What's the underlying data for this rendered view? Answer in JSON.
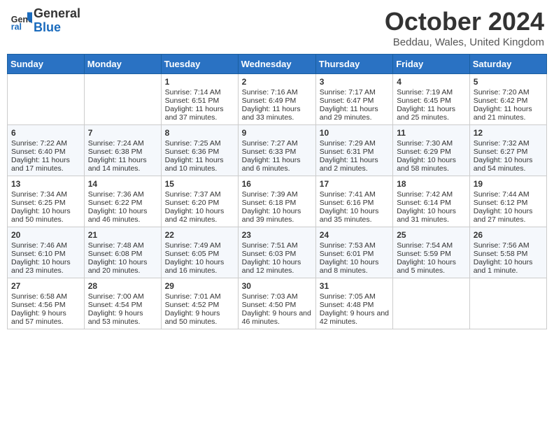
{
  "header": {
    "logo_line1": "General",
    "logo_line2": "Blue",
    "month": "October 2024",
    "location": "Beddau, Wales, United Kingdom"
  },
  "days_of_week": [
    "Sunday",
    "Monday",
    "Tuesday",
    "Wednesday",
    "Thursday",
    "Friday",
    "Saturday"
  ],
  "weeks": [
    [
      {
        "day": "",
        "content": ""
      },
      {
        "day": "",
        "content": ""
      },
      {
        "day": "1",
        "content": "Sunrise: 7:14 AM\nSunset: 6:51 PM\nDaylight: 11 hours and 37 minutes."
      },
      {
        "day": "2",
        "content": "Sunrise: 7:16 AM\nSunset: 6:49 PM\nDaylight: 11 hours and 33 minutes."
      },
      {
        "day": "3",
        "content": "Sunrise: 7:17 AM\nSunset: 6:47 PM\nDaylight: 11 hours and 29 minutes."
      },
      {
        "day": "4",
        "content": "Sunrise: 7:19 AM\nSunset: 6:45 PM\nDaylight: 11 hours and 25 minutes."
      },
      {
        "day": "5",
        "content": "Sunrise: 7:20 AM\nSunset: 6:42 PM\nDaylight: 11 hours and 21 minutes."
      }
    ],
    [
      {
        "day": "6",
        "content": "Sunrise: 7:22 AM\nSunset: 6:40 PM\nDaylight: 11 hours and 17 minutes."
      },
      {
        "day": "7",
        "content": "Sunrise: 7:24 AM\nSunset: 6:38 PM\nDaylight: 11 hours and 14 minutes."
      },
      {
        "day": "8",
        "content": "Sunrise: 7:25 AM\nSunset: 6:36 PM\nDaylight: 11 hours and 10 minutes."
      },
      {
        "day": "9",
        "content": "Sunrise: 7:27 AM\nSunset: 6:33 PM\nDaylight: 11 hours and 6 minutes."
      },
      {
        "day": "10",
        "content": "Sunrise: 7:29 AM\nSunset: 6:31 PM\nDaylight: 11 hours and 2 minutes."
      },
      {
        "day": "11",
        "content": "Sunrise: 7:30 AM\nSunset: 6:29 PM\nDaylight: 10 hours and 58 minutes."
      },
      {
        "day": "12",
        "content": "Sunrise: 7:32 AM\nSunset: 6:27 PM\nDaylight: 10 hours and 54 minutes."
      }
    ],
    [
      {
        "day": "13",
        "content": "Sunrise: 7:34 AM\nSunset: 6:25 PM\nDaylight: 10 hours and 50 minutes."
      },
      {
        "day": "14",
        "content": "Sunrise: 7:36 AM\nSunset: 6:22 PM\nDaylight: 10 hours and 46 minutes."
      },
      {
        "day": "15",
        "content": "Sunrise: 7:37 AM\nSunset: 6:20 PM\nDaylight: 10 hours and 42 minutes."
      },
      {
        "day": "16",
        "content": "Sunrise: 7:39 AM\nSunset: 6:18 PM\nDaylight: 10 hours and 39 minutes."
      },
      {
        "day": "17",
        "content": "Sunrise: 7:41 AM\nSunset: 6:16 PM\nDaylight: 10 hours and 35 minutes."
      },
      {
        "day": "18",
        "content": "Sunrise: 7:42 AM\nSunset: 6:14 PM\nDaylight: 10 hours and 31 minutes."
      },
      {
        "day": "19",
        "content": "Sunrise: 7:44 AM\nSunset: 6:12 PM\nDaylight: 10 hours and 27 minutes."
      }
    ],
    [
      {
        "day": "20",
        "content": "Sunrise: 7:46 AM\nSunset: 6:10 PM\nDaylight: 10 hours and 23 minutes."
      },
      {
        "day": "21",
        "content": "Sunrise: 7:48 AM\nSunset: 6:08 PM\nDaylight: 10 hours and 20 minutes."
      },
      {
        "day": "22",
        "content": "Sunrise: 7:49 AM\nSunset: 6:05 PM\nDaylight: 10 hours and 16 minutes."
      },
      {
        "day": "23",
        "content": "Sunrise: 7:51 AM\nSunset: 6:03 PM\nDaylight: 10 hours and 12 minutes."
      },
      {
        "day": "24",
        "content": "Sunrise: 7:53 AM\nSunset: 6:01 PM\nDaylight: 10 hours and 8 minutes."
      },
      {
        "day": "25",
        "content": "Sunrise: 7:54 AM\nSunset: 5:59 PM\nDaylight: 10 hours and 5 minutes."
      },
      {
        "day": "26",
        "content": "Sunrise: 7:56 AM\nSunset: 5:58 PM\nDaylight: 10 hours and 1 minute."
      }
    ],
    [
      {
        "day": "27",
        "content": "Sunrise: 6:58 AM\nSunset: 4:56 PM\nDaylight: 9 hours and 57 minutes."
      },
      {
        "day": "28",
        "content": "Sunrise: 7:00 AM\nSunset: 4:54 PM\nDaylight: 9 hours and 53 minutes."
      },
      {
        "day": "29",
        "content": "Sunrise: 7:01 AM\nSunset: 4:52 PM\nDaylight: 9 hours and 50 minutes."
      },
      {
        "day": "30",
        "content": "Sunrise: 7:03 AM\nSunset: 4:50 PM\nDaylight: 9 hours and 46 minutes."
      },
      {
        "day": "31",
        "content": "Sunrise: 7:05 AM\nSunset: 4:48 PM\nDaylight: 9 hours and 42 minutes."
      },
      {
        "day": "",
        "content": ""
      },
      {
        "day": "",
        "content": ""
      }
    ]
  ]
}
